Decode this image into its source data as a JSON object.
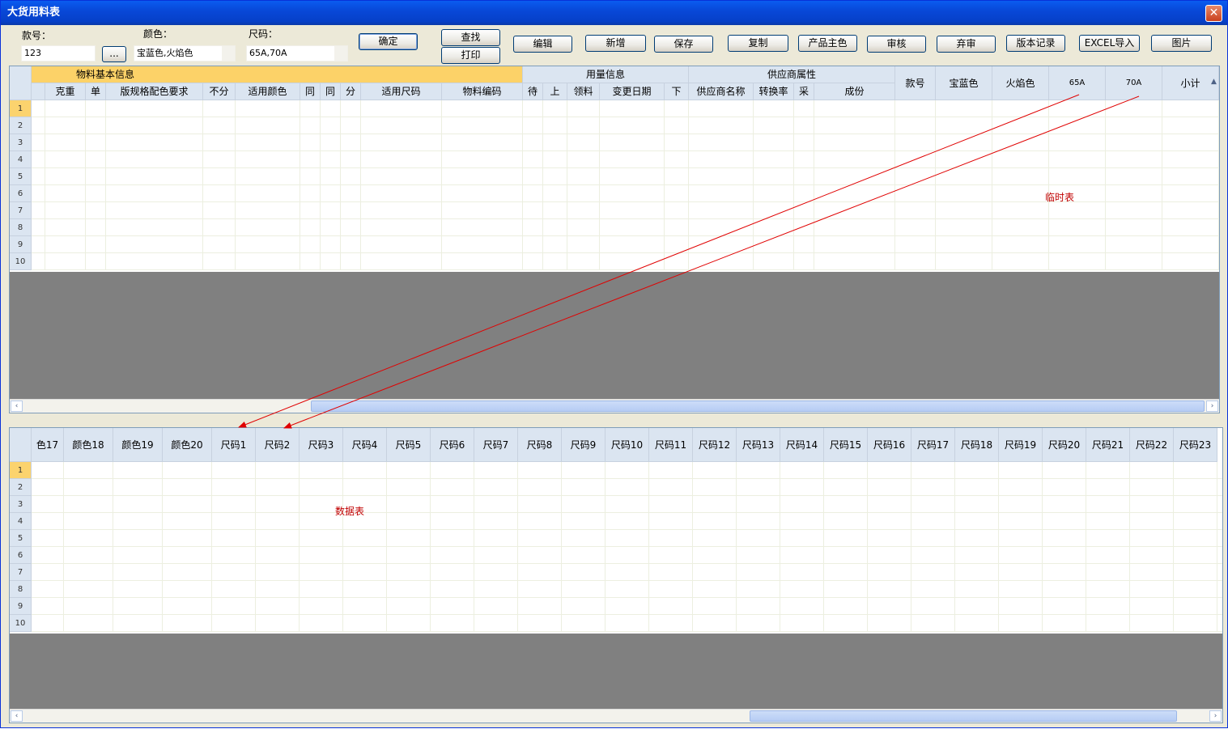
{
  "window": {
    "title": "大货用料表",
    "close": "✕"
  },
  "filters": {
    "style_label": "款号：",
    "style_value": "123",
    "browse_label": "...",
    "color_label": "颜色：",
    "color_value": "宝蓝色,火焰色",
    "size_label": "尺码：",
    "size_value": "65A,70A"
  },
  "toolbar": {
    "confirm": "确定",
    "find": "查找",
    "print": "打印",
    "edit": "编辑",
    "add": "新增",
    "save": "保存",
    "copy": "复制",
    "product_main_color": "产品主色",
    "review": "审核",
    "unreview": "弃审",
    "version_log": "版本记录",
    "excel_import": "EXCEL导入",
    "picture": "图片"
  },
  "temp_grid": {
    "group_headers": [
      "物料基本信息",
      "用量信息",
      "供应商属性"
    ],
    "columns": [
      "克重",
      "单",
      "版规格配色要求",
      "不分",
      "适用颜色",
      "同",
      "同",
      "分",
      "适用尺码",
      "物料编码",
      "待",
      "上",
      "领料",
      "变更日期",
      "下",
      "供应商名称",
      "转换率",
      "采",
      "成份"
    ],
    "right_columns": [
      "款号",
      "宝蓝色",
      "火焰色",
      "65A",
      "70A",
      "小计"
    ],
    "rows": [
      "1",
      "2",
      "3",
      "4",
      "5",
      "6",
      "7",
      "8",
      "9",
      "10"
    ],
    "annotation": "临时表"
  },
  "data_grid": {
    "columns": [
      "色17",
      "颜色18",
      "颜色19",
      "颜色20",
      "尺码1",
      "尺码2",
      "尺码3",
      "尺码4",
      "尺码5",
      "尺码6",
      "尺码7",
      "尺码8",
      "尺码9",
      "尺码10",
      "尺码11",
      "尺码12",
      "尺码13",
      "尺码14",
      "尺码15",
      "尺码16",
      "尺码17",
      "尺码18",
      "尺码19",
      "尺码20",
      "尺码21",
      "尺码22",
      "尺码23"
    ],
    "rows": [
      "1",
      "2",
      "3",
      "4",
      "5",
      "6",
      "7",
      "8",
      "9",
      "10"
    ],
    "annotation": "数据表"
  },
  "colors": {
    "title_bar": "#0848d8",
    "header_bg": "#dbe5f1",
    "active_row": "#fbd36e",
    "annotation": "#c00000"
  },
  "icons": {
    "scroll_left": "‹",
    "scroll_right": "›",
    "lock": "🔒"
  }
}
